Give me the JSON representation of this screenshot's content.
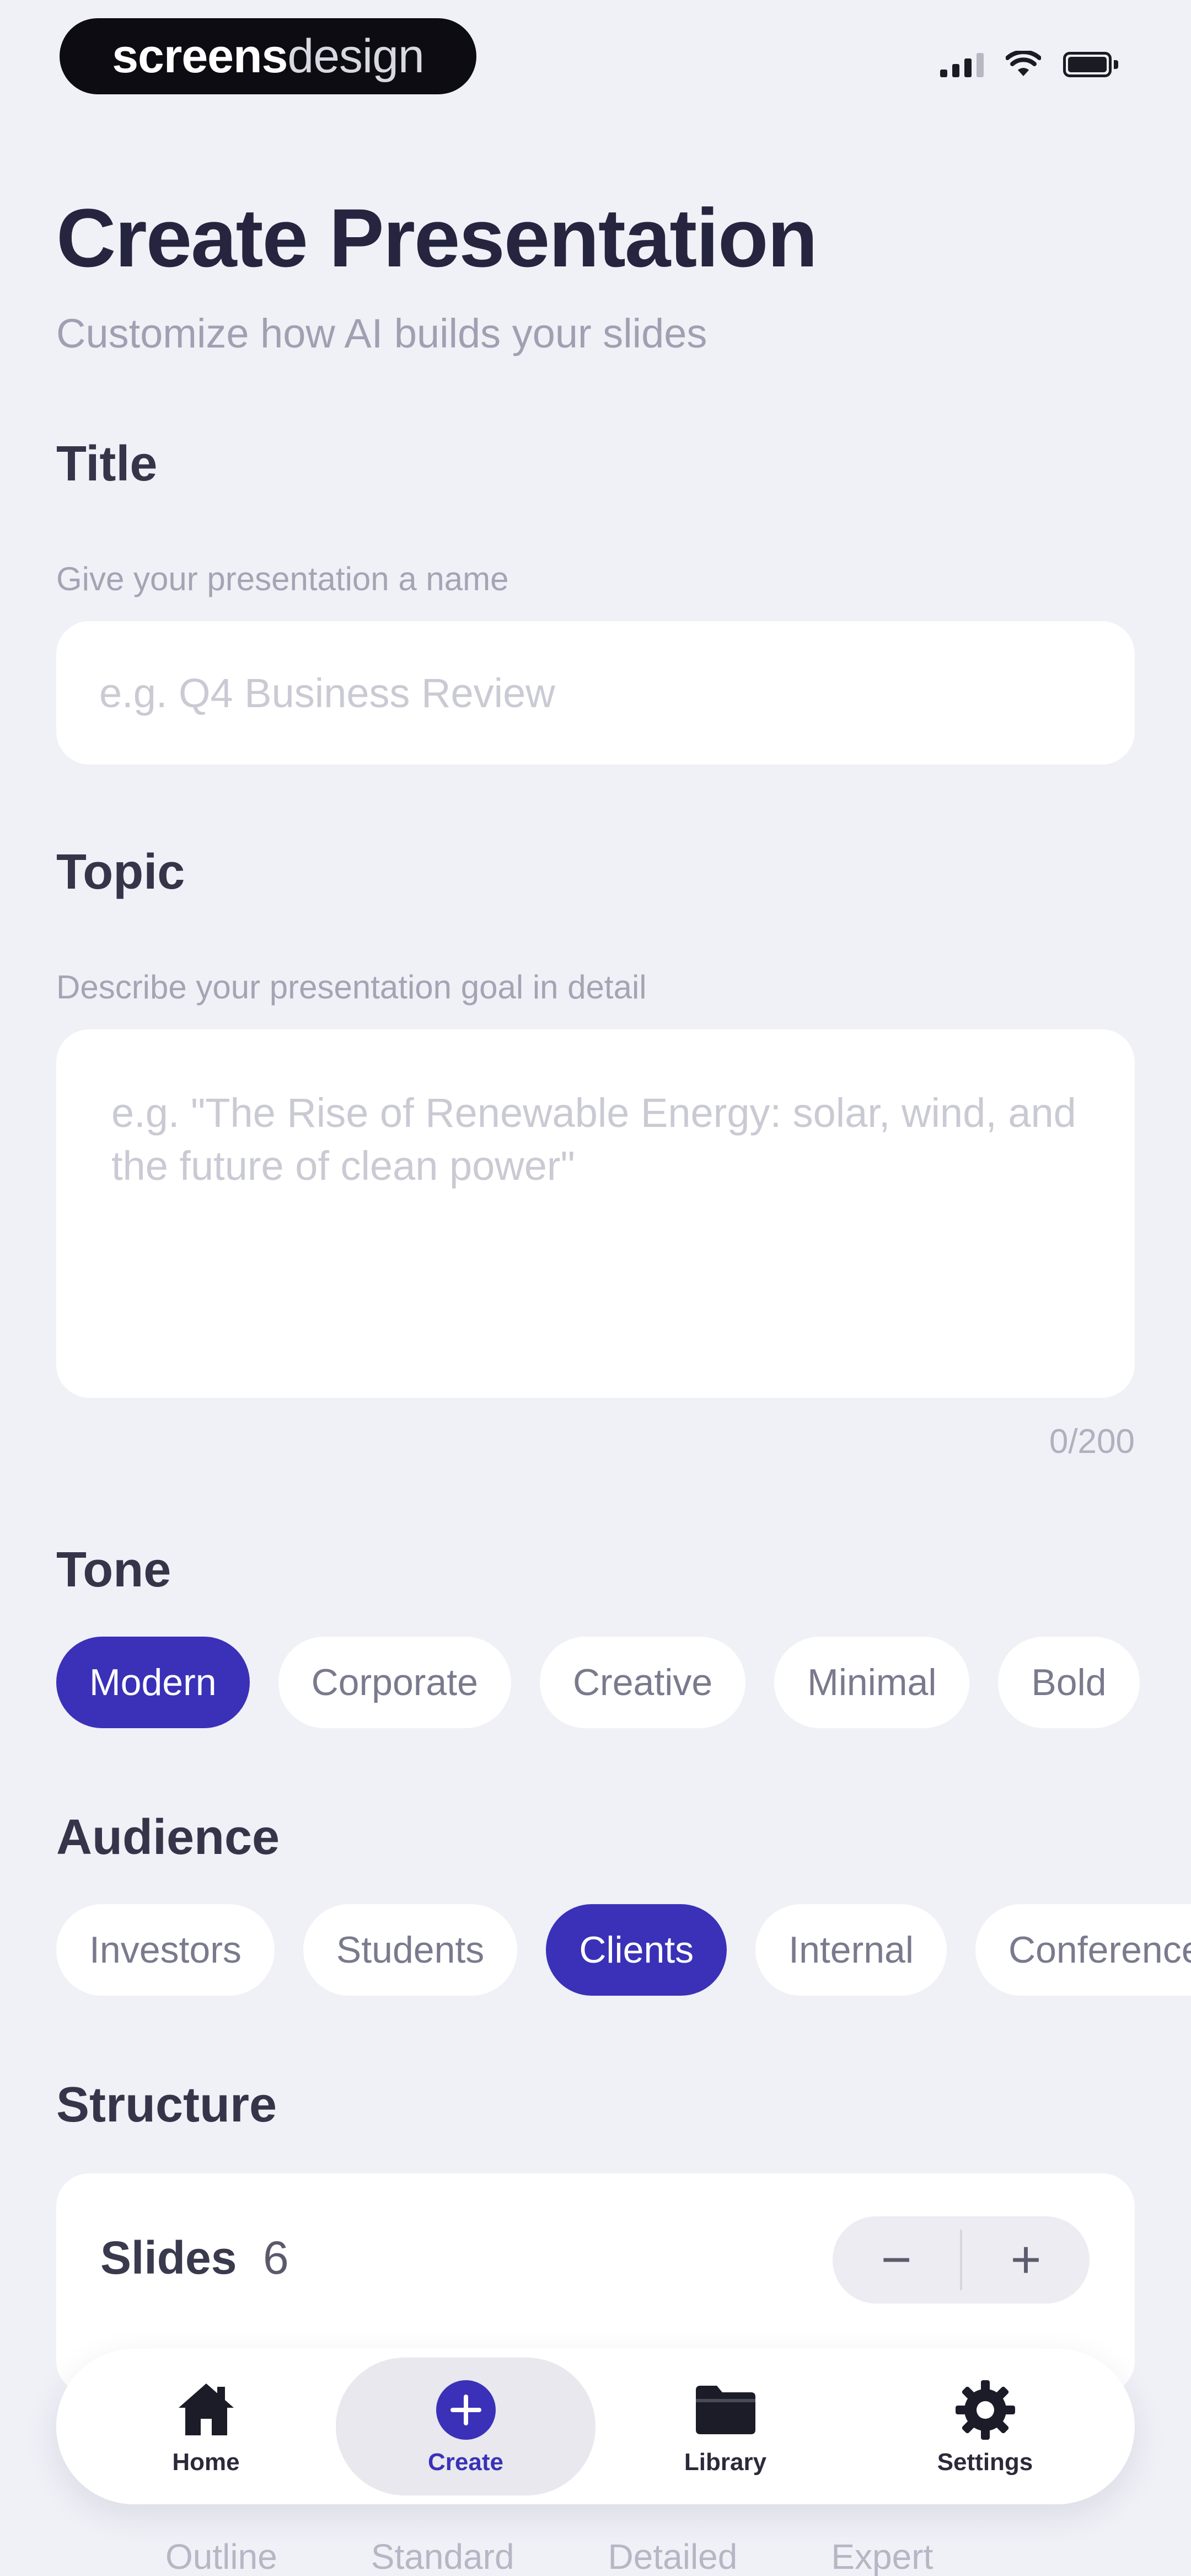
{
  "status_bar": {
    "brand_bold": "screens",
    "brand_light": "design"
  },
  "header": {
    "title": "Create Presentation",
    "subtitle": "Customize how AI builds your slides"
  },
  "title_section": {
    "label": "Title",
    "helper": "Give your presentation a name",
    "placeholder": "e.g. Q4 Business Review",
    "value": ""
  },
  "topic_section": {
    "label": "Topic",
    "helper": "Describe your presentation goal in detail",
    "placeholder": "e.g. \"The Rise of Renewable Energy: solar, wind, and the future of clean power\"",
    "value": "",
    "char_count": "0/200"
  },
  "tone_section": {
    "label": "Tone",
    "options": [
      {
        "label": "Modern",
        "selected": true
      },
      {
        "label": "Corporate",
        "selected": false
      },
      {
        "label": "Creative",
        "selected": false
      },
      {
        "label": "Minimal",
        "selected": false
      },
      {
        "label": "Bold",
        "selected": false
      }
    ]
  },
  "audience_section": {
    "label": "Audience",
    "options": [
      {
        "label": "Investors",
        "selected": false
      },
      {
        "label": "Students",
        "selected": false
      },
      {
        "label": "Clients",
        "selected": true
      },
      {
        "label": "Internal",
        "selected": false
      },
      {
        "label": "Conference",
        "selected": false
      }
    ]
  },
  "structure_section": {
    "label": "Structure",
    "slides_label": "Slides",
    "slides_count": "6",
    "decrement_label": "−",
    "increment_label": "+",
    "depth_options": [
      "Outline",
      "Standard",
      "Detailed",
      "Expert"
    ]
  },
  "tab_bar": {
    "items": [
      {
        "label": "Home",
        "icon": "home-icon",
        "active": false
      },
      {
        "label": "Create",
        "icon": "plus-circle-icon",
        "active": true
      },
      {
        "label": "Library",
        "icon": "folder-icon",
        "active": false
      },
      {
        "label": "Settings",
        "icon": "gear-icon",
        "active": false
      }
    ]
  },
  "colors": {
    "accent": "#3a31b8",
    "background": "#f0f0f7",
    "card": "#ffffff",
    "text_primary": "#26253f",
    "text_muted": "#a0a0b2"
  }
}
